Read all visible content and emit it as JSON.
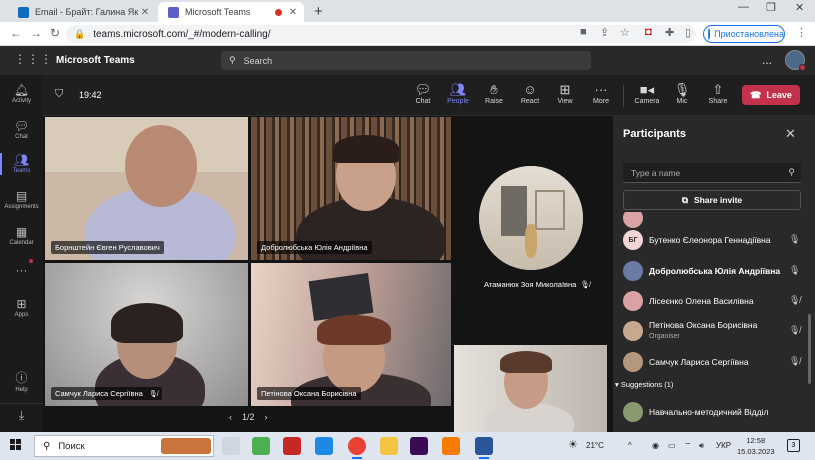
{
  "browser": {
    "tabs": [
      {
        "title": "Email - Брайт: Галина Якідіна - О",
        "active": false,
        "favicon_color": "#0f6cbd"
      },
      {
        "title": "Microsoft Teams",
        "active": true,
        "favicon_color": "#5b5fc7"
      }
    ],
    "url": "teams.microsoft.com/_#/modern-calling/",
    "profile_status": "Приостановлена"
  },
  "teams": {
    "app_name": "Microsoft Teams",
    "search_placeholder": "Search",
    "more_label": "...",
    "rail": [
      {
        "label": "Activity",
        "icon": "bell-icon"
      },
      {
        "label": "Chat",
        "icon": "chat-icon"
      },
      {
        "label": "Teams",
        "icon": "teams-icon",
        "active": true
      },
      {
        "label": "Assignments",
        "icon": "assignments-icon"
      },
      {
        "label": "Calendar",
        "icon": "calendar-icon"
      },
      {
        "label": "",
        "icon": "more-icon"
      },
      {
        "label": "Apps",
        "icon": "apps-icon"
      },
      {
        "label": "Help",
        "icon": "help-icon"
      }
    ]
  },
  "meeting": {
    "timer": "19:42",
    "controls": [
      {
        "label": "Chat",
        "icon": "chat-icon"
      },
      {
        "label": "People",
        "icon": "people-icon",
        "active": true
      },
      {
        "label": "Raise",
        "icon": "hand-icon"
      },
      {
        "label": "React",
        "icon": "smile-icon"
      },
      {
        "label": "View",
        "icon": "grid-icon"
      },
      {
        "label": "More",
        "icon": "more-icon"
      },
      {
        "label": "Camera",
        "icon": "camera-icon"
      },
      {
        "label": "Mic",
        "icon": "mic-off-icon"
      },
      {
        "label": "Share",
        "icon": "share-icon"
      }
    ],
    "leave_label": "Leave",
    "tiles": [
      {
        "name": "Борнштейн Євген Руславович",
        "muted": false
      },
      {
        "name": "Добролюбська Юлія Андріївна",
        "muted": false
      },
      {
        "name": "Самчук Лариса Сергіївна",
        "muted": true
      },
      {
        "name": "Петінова Оксана Борисівна",
        "muted": false
      }
    ],
    "round_participant": "Атаманюк Зоя Миколаївна",
    "page": "1/2"
  },
  "participants": {
    "title": "Participants",
    "search_placeholder": "Type a name",
    "share_invite": "Share invite",
    "people": [
      {
        "initials": "БГ",
        "name": "Бутенко Єлеонора Геннадіївна",
        "role": "",
        "mic": "on",
        "avatar_color": "#f2d6d6"
      },
      {
        "initials": "",
        "name": "Добролюбська Юлія Андріївна",
        "role": "",
        "mic": "on",
        "avatar_color": "#6b7aa5"
      },
      {
        "initials": "",
        "name": "Лісеєнко Олена Василівна",
        "role": "",
        "mic": "off",
        "avatar_color": "#d9a3a3"
      },
      {
        "initials": "",
        "name": "Петінова Оксана Борисівна",
        "role": "Organiser",
        "mic": "off",
        "avatar_color": "#c9a98e"
      },
      {
        "initials": "",
        "name": "Самчук Лариса Сергіївна",
        "role": "",
        "mic": "off",
        "avatar_color": "#b4977f"
      }
    ],
    "suggestions_label": "Suggestions (1)",
    "suggestion": "Навчально-методичний Відділ"
  },
  "taskbar": {
    "search_placeholder": "Поиск",
    "temperature": "21°C",
    "language": "УКР",
    "time": "12:58",
    "date": "15.03.2023",
    "notifications": "3"
  }
}
